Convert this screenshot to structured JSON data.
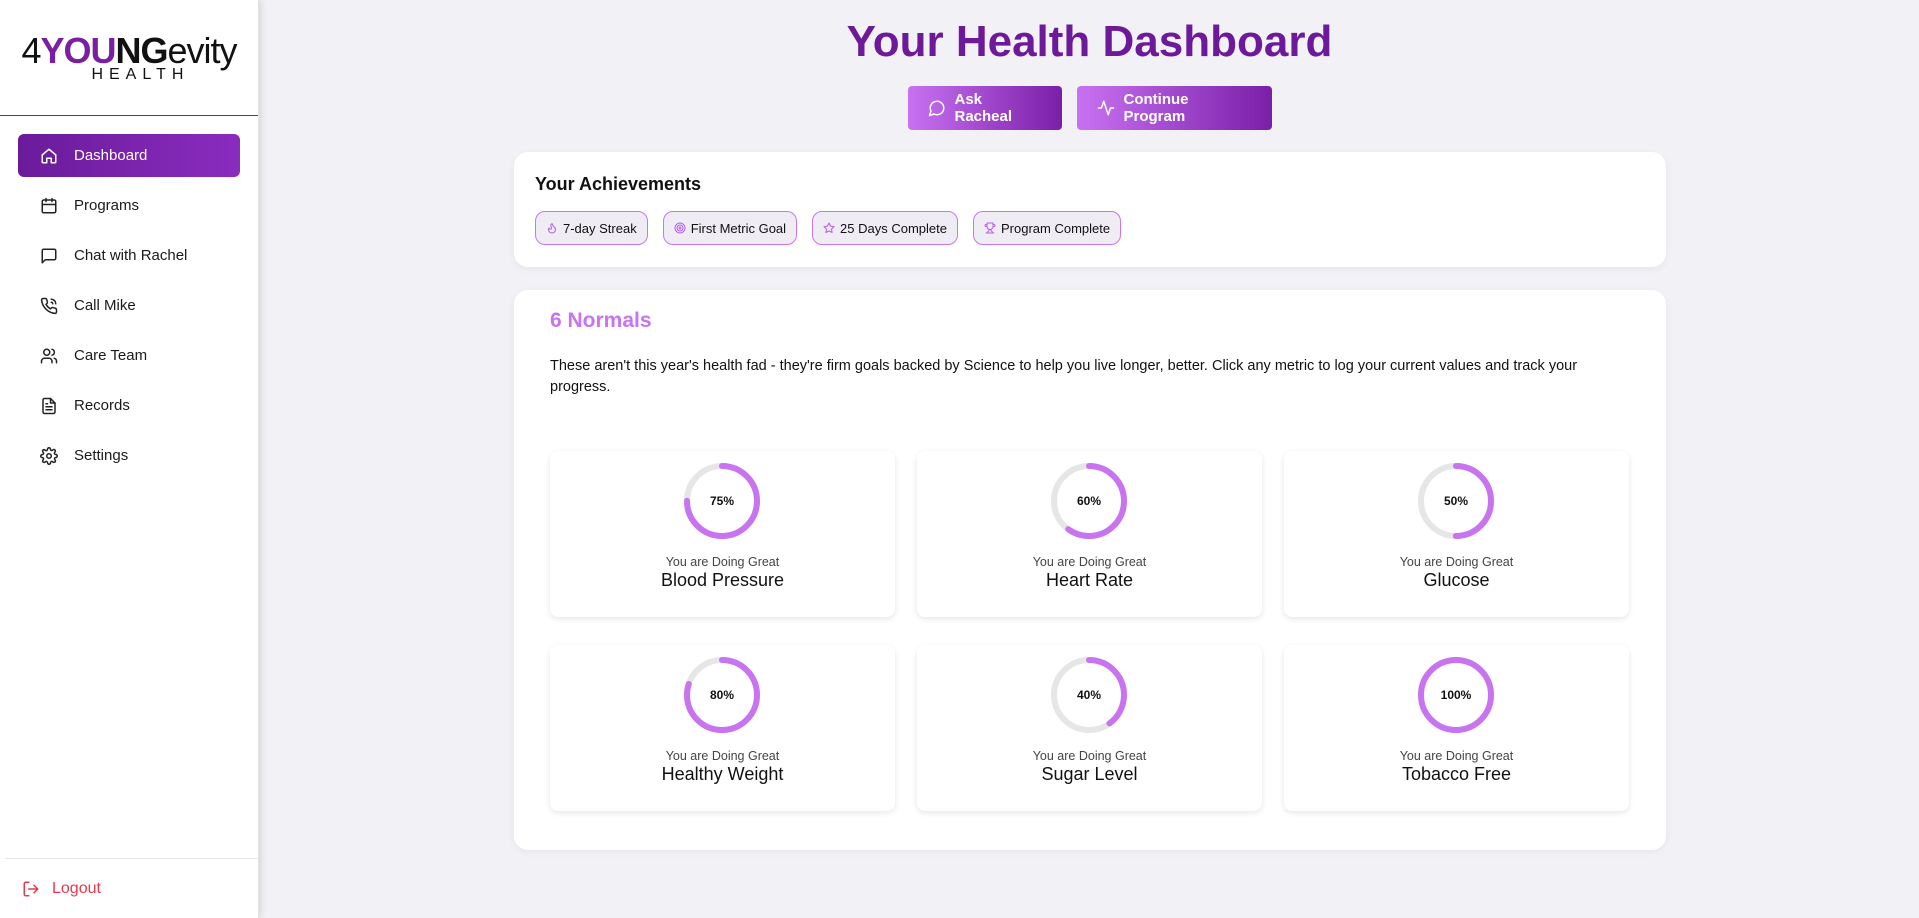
{
  "brand": {
    "logo_text_top_prefix": "4",
    "logo_text_top_y": "YOU",
    "logo_text_top_bold": "NG",
    "logo_text_top_suffix": "evity",
    "logo_text_bottom": "HEALTH",
    "accent": "#6c1a9a",
    "accent_light": "#c874f0"
  },
  "sidebar": {
    "items": [
      {
        "label": "Dashboard",
        "icon": "home-icon",
        "active": true
      },
      {
        "label": "Programs",
        "icon": "calendar-icon"
      },
      {
        "label": "Chat with Rachel",
        "icon": "chat-icon"
      },
      {
        "label": "Call Mike",
        "icon": "phone-icon"
      },
      {
        "label": "Care Team",
        "icon": "users-icon"
      },
      {
        "label": "Records",
        "icon": "document-icon"
      },
      {
        "label": "Settings",
        "icon": "gear-icon"
      }
    ],
    "logout_label": "Logout"
  },
  "header": {
    "title": "Your Health Dashboard",
    "ask_label": "Ask Racheal",
    "continue_label": "Continue Program"
  },
  "achievements": {
    "title": "Your Achievements",
    "badges": [
      {
        "label": "7-day Streak",
        "icon": "flame-icon"
      },
      {
        "label": "First Metric Goal",
        "icon": "target-icon"
      },
      {
        "label": "25 Days Complete",
        "icon": "star-icon"
      },
      {
        "label": "Program Complete",
        "icon": "trophy-icon"
      }
    ]
  },
  "normals": {
    "title": "6 Normals",
    "description": "These aren't this year's health fad - they're firm goals backed by Science to help you live longer, better. Click any metric to log your current values and track your progress.",
    "metrics": [
      {
        "name": "Blood Pressure",
        "percent": 75,
        "percent_label": "75%",
        "status": "You are Doing Great"
      },
      {
        "name": "Heart Rate",
        "percent": 60,
        "percent_label": "60%",
        "status": "You are Doing Great"
      },
      {
        "name": "Glucose",
        "percent": 50,
        "percent_label": "50%",
        "status": "You are Doing Great"
      },
      {
        "name": "Healthy Weight",
        "percent": 80,
        "percent_label": "80%",
        "status": "You are Doing Great"
      },
      {
        "name": "Sugar Level",
        "percent": 40,
        "percent_label": "40%",
        "status": "You are Doing Great"
      },
      {
        "name": "Tobacco Free",
        "percent": 100,
        "percent_label": "100%",
        "status": "You are Doing Great"
      }
    ],
    "ring_color": "#c874f0",
    "ring_track_color": "#e6e6e6"
  }
}
